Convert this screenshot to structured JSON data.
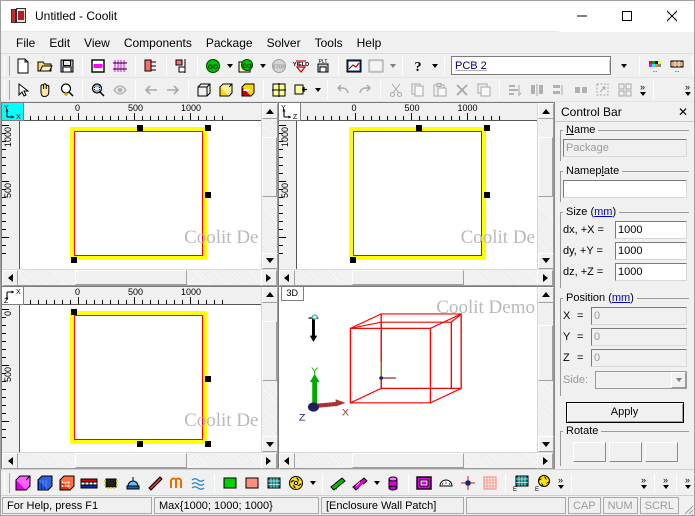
{
  "window": {
    "title": "Untitled - Coolit",
    "icon": "coolit-app-icon",
    "minimize": "─",
    "maximize": "☐",
    "close": "✕"
  },
  "menu": {
    "items": [
      {
        "label": "File"
      },
      {
        "label": "Edit"
      },
      {
        "label": "View"
      },
      {
        "label": "Components"
      },
      {
        "label": "Package"
      },
      {
        "label": "Solver"
      },
      {
        "label": "Tools"
      },
      {
        "label": "Help"
      }
    ]
  },
  "toolbar_main": {
    "buttons": [
      {
        "name": "new-file-icon",
        "enabled": true
      },
      {
        "name": "open-folder-icon",
        "enabled": true
      },
      {
        "name": "save-disk-icon",
        "enabled": true
      },
      {
        "name": "package-window-icon",
        "enabled": true
      },
      {
        "name": "grid-mesh-icon",
        "enabled": true
      },
      {
        "name": "tree-list-icon",
        "enabled": true
      },
      {
        "name": "align-objects-icon",
        "enabled": true
      },
      {
        "name": "go-solve-icon",
        "enabled": true
      },
      {
        "name": "go-solve-notes-icon",
        "enabled": true
      },
      {
        "name": "stop-icon",
        "enabled": false
      },
      {
        "name": "yield-icon",
        "enabled": true
      },
      {
        "name": "plt-save-icon",
        "enabled": true
      },
      {
        "name": "plot-view-icon",
        "enabled": true
      },
      {
        "name": "plot-data-icon",
        "enabled": false
      },
      {
        "name": "help-question-icon",
        "enabled": true
      }
    ],
    "combo": {
      "name": "object-selector",
      "value": "PCB 2"
    },
    "right_buttons": [
      {
        "name": "color-palette-icon",
        "enabled": true
      },
      {
        "name": "texture-palette-icon",
        "enabled": true
      },
      {
        "name": "material-fill-icon",
        "enabled": true
      }
    ],
    "overflow": "»"
  },
  "toolbar_view": {
    "buttons": [
      {
        "name": "select-arrow-icon",
        "enabled": true
      },
      {
        "name": "pan-hand-icon",
        "enabled": true
      },
      {
        "name": "zoom-region-icon",
        "enabled": true
      },
      {
        "name": "zoom-glass-icon",
        "enabled": true
      },
      {
        "name": "eye-view-icon",
        "enabled": false
      },
      {
        "name": "back-arrow-icon",
        "enabled": false
      },
      {
        "name": "forward-arrow-icon",
        "enabled": false
      },
      {
        "name": "wireframe-cube-icon",
        "enabled": true
      },
      {
        "name": "solid-cube-icon",
        "enabled": true
      },
      {
        "name": "section-cube-icon",
        "enabled": true
      },
      {
        "name": "grid-snap-icon",
        "enabled": true
      },
      {
        "name": "add-grid-icon",
        "enabled": true
      },
      {
        "name": "undo-icon",
        "enabled": false
      },
      {
        "name": "redo-icon",
        "enabled": false
      },
      {
        "name": "cut-icon",
        "enabled": false
      },
      {
        "name": "copy-icon",
        "enabled": false
      },
      {
        "name": "paste-icon",
        "enabled": false
      },
      {
        "name": "delete-x-icon",
        "enabled": false
      },
      {
        "name": "duplicate-icon",
        "enabled": false
      },
      {
        "name": "align-left-icon",
        "enabled": false
      },
      {
        "name": "align-center-icon",
        "enabled": false
      },
      {
        "name": "align-right-icon",
        "enabled": false
      },
      {
        "name": "distribute-icon",
        "enabled": false
      },
      {
        "name": "resize-icon",
        "enabled": false
      },
      {
        "name": "group-icon",
        "enabled": false
      }
    ],
    "overflow": "»"
  },
  "views": [
    {
      "id": "view-xy",
      "axis_vertical": "Y",
      "axis_horizontal": "X",
      "corner_color": "#00ffff",
      "ruler_h_labels": [
        "0",
        "500",
        "1000"
      ],
      "ruler_v_labels": [
        "1000",
        "500"
      ],
      "watermark": "Coolit De",
      "shape": {
        "outer_color": "#ffff00",
        "inner_color": "#ff0000"
      }
    },
    {
      "id": "view-yz",
      "axis_vertical": "Y",
      "axis_horizontal": "Z",
      "corner_color": "#ffffff",
      "ruler_h_labels": [
        "0",
        "500",
        "1000"
      ],
      "ruler_v_labels": [
        "1000",
        "500"
      ],
      "watermark": "Coolit De",
      "shape": {
        "outer_color": "#ffff00",
        "inner_color": "#ff0000"
      }
    },
    {
      "id": "view-zx",
      "axis_vertical": "Z",
      "axis_horizontal": "X",
      "corner_color": "#ffffff",
      "ruler_h_labels": [
        "0",
        "500",
        "1000"
      ],
      "ruler_v_labels": [
        "0",
        "500"
      ],
      "watermark": "Coolit De",
      "shape": {
        "outer_color": "#ffff00",
        "inner_color": "#ff0000"
      }
    },
    {
      "id": "view-3d",
      "tab_label": "3D",
      "watermark": "Coolit Demo",
      "gravity_label": "g",
      "axes": {
        "x": "X",
        "y": "Y",
        "z": "Z"
      },
      "wireframe_color": "#ff0000"
    }
  ],
  "control_bar": {
    "title": "Control Bar",
    "close": "✕",
    "name_group": {
      "legend": "Name",
      "legend_mnemonic": "N",
      "value": "Package",
      "enabled": false
    },
    "nameplate_group": {
      "legend": "Nameplate",
      "legend_mnemonic": "l",
      "value": "",
      "enabled": true
    },
    "size_group": {
      "legend": "Size",
      "unit": "mm",
      "fields": [
        {
          "label": "dx, +X =",
          "value": "1000",
          "name": "size-dx-input"
        },
        {
          "label": "dy, +Y =",
          "value": "1000",
          "name": "size-dy-input"
        },
        {
          "label": "dz, +Z =",
          "value": "1000",
          "name": "size-dz-input"
        }
      ]
    },
    "position_group": {
      "legend": "Position",
      "unit": "mm",
      "fields": [
        {
          "label": "X",
          "eq": "=",
          "value": "0",
          "name": "position-x-input",
          "enabled": false
        },
        {
          "label": "Y",
          "eq": "=",
          "value": "0",
          "name": "position-y-input",
          "enabled": false
        },
        {
          "label": "Z",
          "eq": "=",
          "value": "0",
          "name": "position-z-input",
          "enabled": false
        }
      ],
      "side_label": "Side:",
      "side_value": "",
      "side_enabled": false
    },
    "apply_button": "Apply",
    "rotate_group": {
      "legend": "Rotate"
    }
  },
  "toolbar_components": {
    "buttons": [
      {
        "name": "block-magenta-icon"
      },
      {
        "name": "block-blue-icon"
      },
      {
        "name": "block-perforated-icon"
      },
      {
        "name": "heatsink-icon"
      },
      {
        "name": "ic-chip-icon"
      },
      {
        "name": "fan-dome-icon"
      },
      {
        "name": "resistor-icon"
      },
      {
        "name": "coil-icon"
      },
      {
        "name": "flow-waves-icon"
      },
      {
        "name": "plate-green-icon"
      },
      {
        "name": "plate-salmon-icon"
      },
      {
        "name": "pcb-grid-icon"
      },
      {
        "name": "fan-rotor-icon"
      },
      {
        "name": "ramp-green-icon"
      },
      {
        "name": "ramp-magenta-icon"
      },
      {
        "name": "cylinder-icon"
      },
      {
        "name": "enclosure-icon"
      },
      {
        "name": "gauge-icon"
      },
      {
        "name": "point-monitor-icon"
      },
      {
        "name": "grid-plane-icon"
      },
      {
        "name": "mesh-grid-icon"
      },
      {
        "name": "fan-curve-icon"
      }
    ],
    "overflow": "»"
  },
  "status_bar": {
    "help": "For Help, press F1",
    "max": "Max{1000; 1000; 1000}",
    "selection": "[Enclosure Wall Patch]",
    "blank": "",
    "indicators": [
      "CAP",
      "NUM",
      "SCRL"
    ]
  }
}
